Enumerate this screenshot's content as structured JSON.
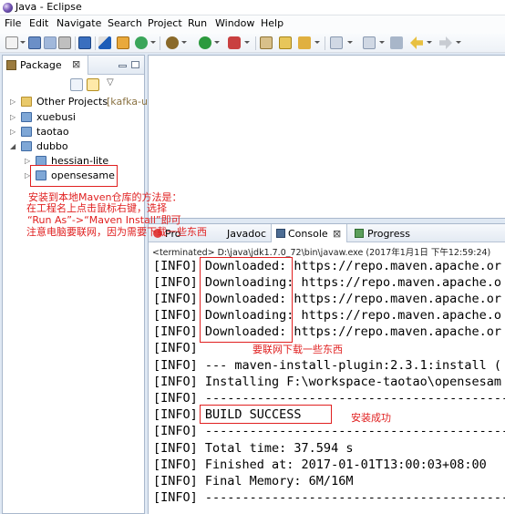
{
  "window": {
    "title": "Java - Eclipse"
  },
  "menu": [
    "File",
    "Edit",
    "Navigate",
    "Search",
    "Project",
    "Run",
    "Window",
    "Help"
  ],
  "package_explorer": {
    "tab_label": "Package",
    "tree": [
      {
        "label": "Other Projects",
        "suffix": "[kafka-ul",
        "type": "folder",
        "level": 0
      },
      {
        "label": "xuebusi",
        "type": "project",
        "level": 0
      },
      {
        "label": "taotao",
        "type": "project",
        "level": 0
      },
      {
        "label": "dubbo",
        "type": "project",
        "level": 0
      },
      {
        "label": "hessian-lite",
        "type": "project",
        "level": 1
      },
      {
        "label": "opensesame",
        "type": "project",
        "level": 1
      }
    ]
  },
  "annotation": {
    "line1": "安装到本地Maven仓库的方法是：",
    "line2": "在工程名上点击鼠标右键，选择",
    "line3": "“Run As”->“Maven Install”即可",
    "line4": "注意电脑要联网，因为需要下载一些东西"
  },
  "console": {
    "tabs": [
      "Problems",
      "Javadoc",
      "Console",
      "Progress"
    ],
    "tab_problems_partial": "Pro",
    "status": "<terminated> D:\\java\\jdk1.7.0_72\\bin\\javaw.exe (2017年1月1日 下午12:59:24)",
    "lines": [
      "[INFO] Downloaded: https://repo.maven.apache.or",
      "[INFO] Downloading: https://repo.maven.apache.o",
      "[INFO] Downloaded: https://repo.maven.apache.or",
      "[INFO] Downloading: https://repo.maven.apache.o",
      "[INFO] Downloaded: https://repo.maven.apache.or",
      "[INFO]",
      "[INFO] --- maven-install-plugin:2.3.1:install (",
      "[INFO] Installing F:\\workspace-taotao\\opensesam",
      "[INFO] ------------------------------------------",
      "[INFO] BUILD SUCCESS",
      "[INFO] ------------------------------------------",
      "[INFO] Total time: 37.594 s",
      "[INFO] Finished at: 2017-01-01T13:00:03+08:00",
      "[INFO] Final Memory: 6M/16M",
      "[INFO] ------------------------------------------"
    ],
    "note_download": "要联网下载一些东西",
    "note_success": "安装成功"
  }
}
